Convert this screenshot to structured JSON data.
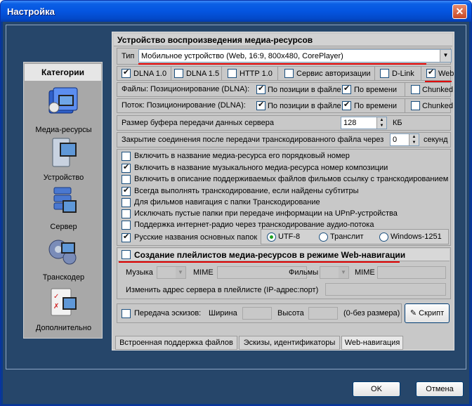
{
  "window": {
    "title": "Настройка",
    "close_glyph": "✕"
  },
  "categories": {
    "title": "Категории",
    "items": [
      {
        "label": "Медиа-ресурсы",
        "icon": "media-resources-icon"
      },
      {
        "label": "Устройство",
        "icon": "device-icon"
      },
      {
        "label": "Сервер",
        "icon": "server-icon"
      },
      {
        "label": "Транскодер",
        "icon": "transcoder-icon"
      },
      {
        "label": "Дополнительно",
        "icon": "additional-icon"
      }
    ]
  },
  "section_title": "Устройство воспроизведения медиа-ресурсов",
  "type_label": "Тип",
  "type_value": "Мобильное устройство (Web, 16:9, 800x480, CorePlayer)",
  "protocols": [
    {
      "label": "DLNA 1.0",
      "checked": true
    },
    {
      "label": "DLNA 1.5",
      "checked": false
    },
    {
      "label": "HTTP 1.0",
      "checked": false
    },
    {
      "label": "Сервис авторизации",
      "checked": false
    },
    {
      "label": "D-Link",
      "checked": false
    },
    {
      "label": "Web",
      "checked": true
    }
  ],
  "files_row": {
    "label": "Файлы: Позиционирование (DLNA):",
    "opt1": "По позиции в файле",
    "opt2": "По времени",
    "opt3": "Chunked"
  },
  "stream_row": {
    "label": "Поток: Позиционирование (DLNA):",
    "opt1": "По позиции в файле",
    "opt2": "По времени",
    "opt3": "Chunked"
  },
  "buffer": {
    "label": "Размер буфера передачи данных сервера",
    "value": "128",
    "unit": "КБ"
  },
  "close_conn": {
    "label": "Закрытие соединения после передачи транскодированного файла через",
    "value": "0",
    "unit": "секунд"
  },
  "options": [
    {
      "label": "Включить в название медиа-ресурса его порядковый номер",
      "checked": false
    },
    {
      "label": "Включить в название музыкального медиа-ресурса номер композиции",
      "checked": true
    },
    {
      "label": "Включить в описание поддерживаемых файлов фильмов ссылку с транскодированием",
      "checked": false
    },
    {
      "label": "Всегда выполнять транскодирование, если найдены субтитры",
      "checked": true
    },
    {
      "label": "Для фильмов навигация с папки Транскодирование",
      "checked": false
    },
    {
      "label": "Исключать пустые папки при передаче информации на  UPnP-устройства",
      "checked": false
    },
    {
      "label": "Поддержка интернет-радио через транскодирование аудио-потока",
      "checked": false
    }
  ],
  "russian_names": {
    "label": "Русские названия основных папок",
    "checked": true,
    "encodings": [
      "UTF-8",
      "Транслит",
      "Windows-1251"
    ],
    "selected": "UTF-8"
  },
  "playlists": {
    "label": "Создание плейлистов медиа-ресурсов в режиме Web-навигации",
    "checked": false,
    "music_label": "Музыка",
    "mime_label": "MIME",
    "films_label": "Фильмы",
    "mime2_label": "MIME",
    "server_addr_label": "Изменить адрес сервера в плейлисте (IP-адрес:порт)"
  },
  "thumbs": {
    "label": "Передача эскизов:",
    "width_label": "Ширина",
    "height_label": "Высота",
    "hint": "(0-без размера)",
    "script_label": "Скрипт"
  },
  "tabs": [
    "Встроенная поддержка файлов",
    "Эскизы, идентификаторы",
    "Web-навигация"
  ],
  "buttons": {
    "ok": "OK",
    "cancel": "Отмена"
  },
  "colors": {
    "title_bar": "#0455e0",
    "client_bg": "#26466a",
    "highlight": "#e00000"
  }
}
